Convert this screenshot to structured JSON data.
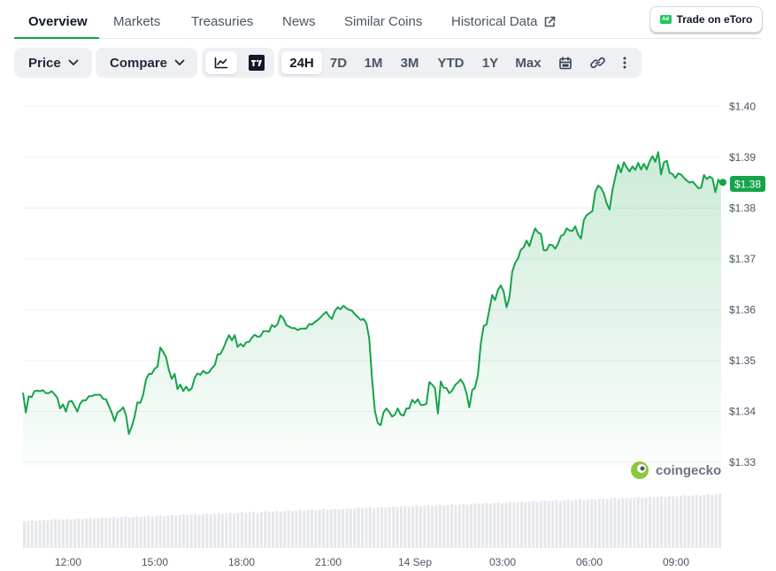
{
  "tabs": [
    {
      "label": "Overview",
      "active": true
    },
    {
      "label": "Markets"
    },
    {
      "label": "Treasuries"
    },
    {
      "label": "News"
    },
    {
      "label": "Similar Coins"
    },
    {
      "label": "Historical Data",
      "icon": "external-link-icon"
    }
  ],
  "ad": {
    "badge": "Ad",
    "label": "Trade on eToro",
    "badge_color": "#22c55e"
  },
  "toolbar": {
    "price_label": "Price",
    "compare_label": "Compare",
    "chart_modes": [
      {
        "icon": "line-chart-icon",
        "active": true
      },
      {
        "icon": "tradingview-icon"
      }
    ],
    "ranges": [
      "24H",
      "7D",
      "1M",
      "3M",
      "YTD",
      "1Y",
      "Max"
    ],
    "active_range": "24H",
    "tools": [
      "calendar-icon",
      "link-icon",
      "more-vertical-icon"
    ]
  },
  "watermark": {
    "text": "coingecko",
    "icon": "gecko-logo-icon"
  },
  "colors": {
    "line": "#16a34a",
    "badge": "#16a34a",
    "active_underline": "#16a34a",
    "volume": "#e5e7eb"
  },
  "chart_data": {
    "type": "area",
    "series": [
      {
        "values": [
          1.3437,
          1.3398,
          1.343,
          1.3428,
          1.344,
          1.3441,
          1.344,
          1.3442,
          1.3436,
          1.3436,
          1.344,
          1.3434,
          1.3427,
          1.3406,
          1.3414,
          1.34,
          1.3419,
          1.3421,
          1.3411,
          1.34,
          1.3416,
          1.3422,
          1.3422,
          1.343,
          1.343,
          1.3433,
          1.3433,
          1.3433,
          1.3425,
          1.3424,
          1.3411,
          1.3398,
          1.3381,
          1.3398,
          1.3402,
          1.3408,
          1.3393,
          1.3356,
          1.337,
          1.339,
          1.3418,
          1.3417,
          1.3433,
          1.3463,
          1.3474,
          1.3474,
          1.3484,
          1.3488,
          1.3526,
          1.3517,
          1.3507,
          1.3481,
          1.3464,
          1.3474,
          1.3444,
          1.3453,
          1.344,
          1.3449,
          1.3441,
          1.3446,
          1.3466,
          1.3475,
          1.3472,
          1.348,
          1.3475,
          1.3477,
          1.3485,
          1.3491,
          1.3512,
          1.3513,
          1.3524,
          1.3538,
          1.355,
          1.354,
          1.355,
          1.3527,
          1.3533,
          1.3528,
          1.3536,
          1.3537,
          1.3545,
          1.3551,
          1.3547,
          1.3548,
          1.3558,
          1.3558,
          1.3557,
          1.357,
          1.3566,
          1.3572,
          1.3589,
          1.3583,
          1.357,
          1.3567,
          1.3564,
          1.3564,
          1.356,
          1.3563,
          1.3563,
          1.3563,
          1.3572,
          1.3571,
          1.3576,
          1.358,
          1.3585,
          1.3591,
          1.3596,
          1.3587,
          1.3582,
          1.3598,
          1.3605,
          1.3601,
          1.3608,
          1.3603,
          1.36,
          1.3598,
          1.3591,
          1.3586,
          1.358,
          1.3582,
          1.3574,
          1.3544,
          1.3464,
          1.3401,
          1.3377,
          1.3373,
          1.3398,
          1.3406,
          1.3399,
          1.339,
          1.3394,
          1.3406,
          1.3394,
          1.3392,
          1.3406,
          1.3406,
          1.3423,
          1.3417,
          1.3424,
          1.3413,
          1.3413,
          1.3415,
          1.3458,
          1.3453,
          1.3446,
          1.3396,
          1.3459,
          1.3447,
          1.3446,
          1.3436,
          1.3441,
          1.3452,
          1.3457,
          1.3463,
          1.3454,
          1.3436,
          1.3408,
          1.3442,
          1.3447,
          1.3472,
          1.3534,
          1.3568,
          1.3571,
          1.3601,
          1.3629,
          1.3619,
          1.3639,
          1.3648,
          1.3636,
          1.3605,
          1.3624,
          1.3675,
          1.3692,
          1.3701,
          1.3718,
          1.3723,
          1.3736,
          1.3725,
          1.3744,
          1.376,
          1.3752,
          1.3749,
          1.3717,
          1.3717,
          1.3728,
          1.3727,
          1.372,
          1.373,
          1.3745,
          1.3748,
          1.376,
          1.3756,
          1.3755,
          1.3764,
          1.3748,
          1.374,
          1.3776,
          1.3786,
          1.379,
          1.3794,
          1.3832,
          1.3844,
          1.384,
          1.3829,
          1.3809,
          1.3797,
          1.3835,
          1.3861,
          1.3885,
          1.387,
          1.389,
          1.388,
          1.3872,
          1.3882,
          1.3875,
          1.3889,
          1.3876,
          1.3887,
          1.3876,
          1.3892,
          1.3902,
          1.3891,
          1.391,
          1.3866,
          1.389,
          1.3893,
          1.3869,
          1.3867,
          1.3859,
          1.3868,
          1.3866,
          1.3859,
          1.3854,
          1.385,
          1.3852,
          1.3846,
          1.3839,
          1.384,
          1.3865,
          1.3857,
          1.3862,
          1.3858,
          1.3831,
          1.3856,
          1.3847
        ]
      }
    ],
    "x_start": "2024-09-13T10:00",
    "x_end": "2024-09-14T10:00",
    "x_ticks": [
      "12:00",
      "15:00",
      "18:00",
      "21:00",
      "14 Sep",
      "03:00",
      "06:00",
      "09:00"
    ],
    "y_ticks": [
      "$1.40",
      "$1.39",
      "$1.38",
      "$1.37",
      "$1.36",
      "$1.35",
      "$1.34",
      "$1.33"
    ],
    "ylim": [
      1.3288,
      1.4004
    ],
    "y_tick_values": [
      1.4,
      1.39,
      1.38,
      1.37,
      1.36,
      1.35,
      1.34,
      1.33
    ],
    "current_price_label": "$1.38",
    "volume": {
      "present": true,
      "trend": "increasing"
    },
    "grid": true
  }
}
